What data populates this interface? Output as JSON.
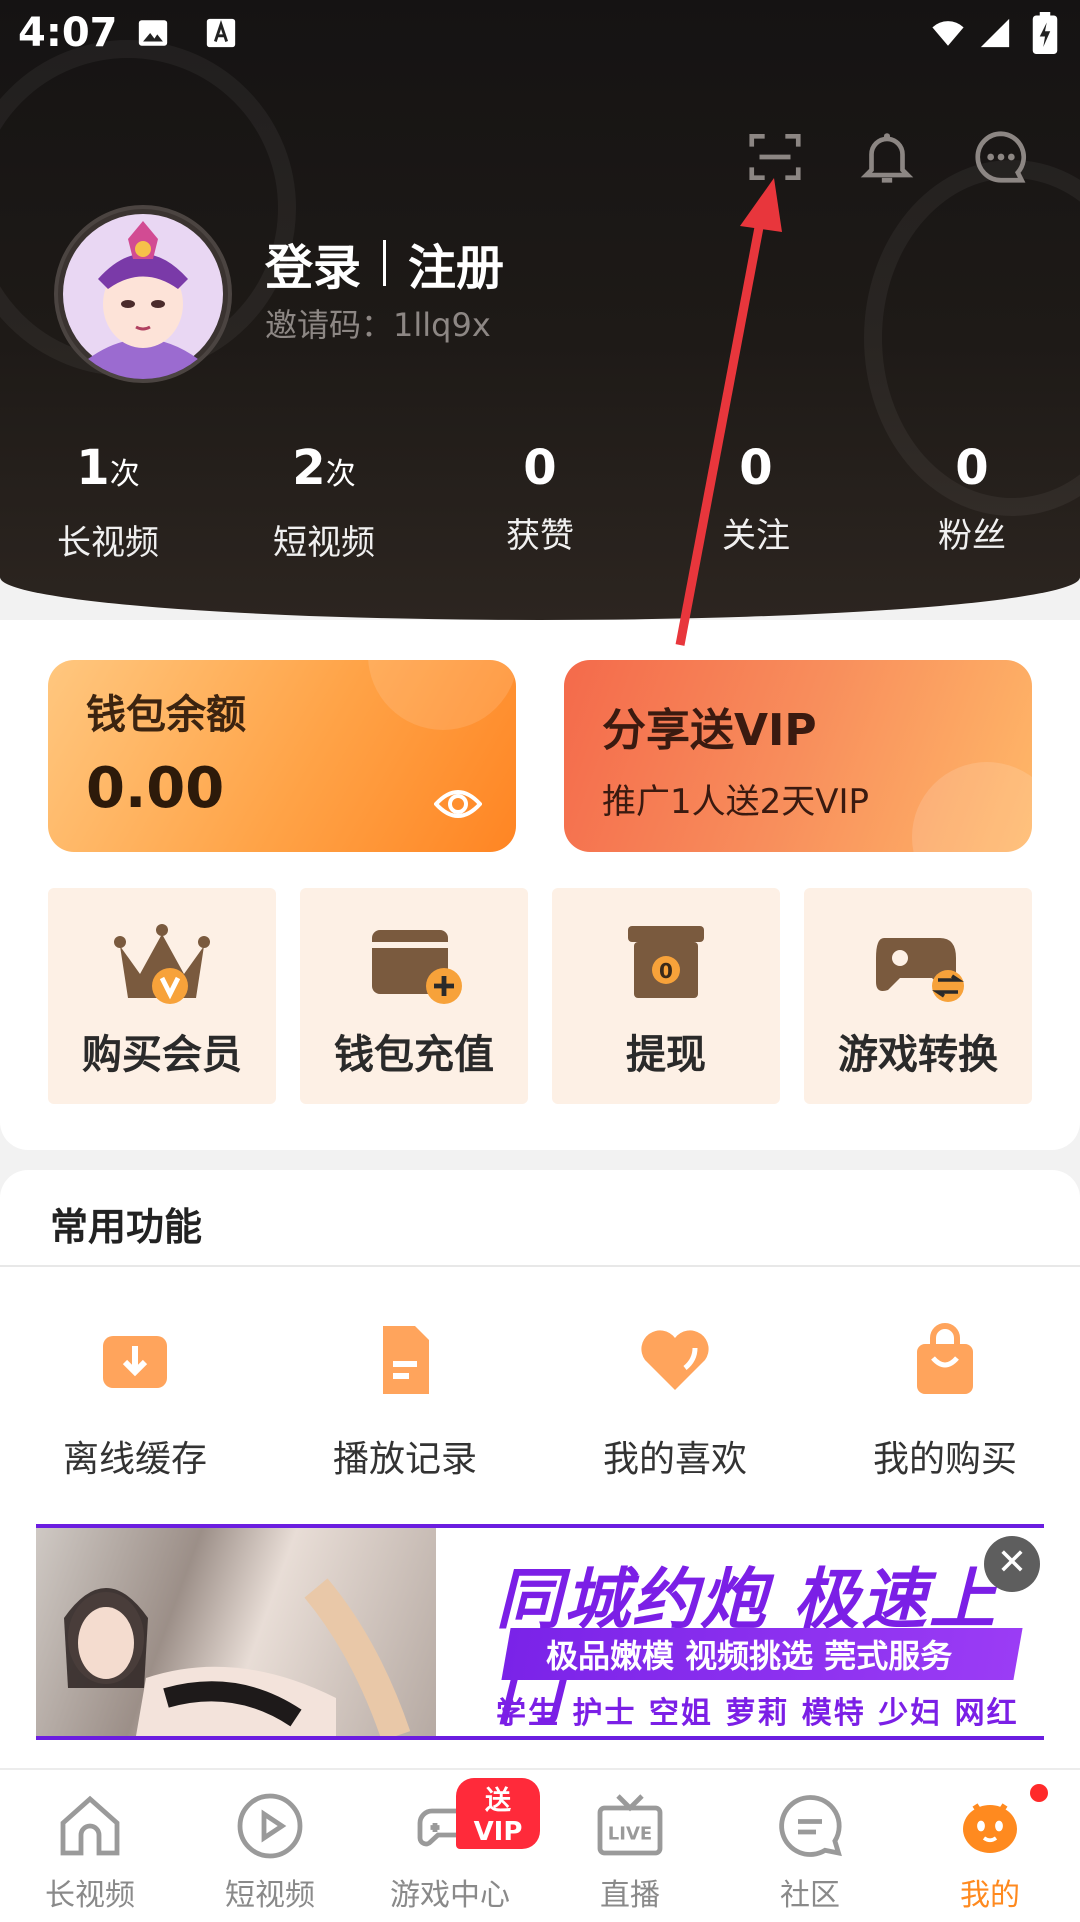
{
  "status_bar": {
    "time": "4:07"
  },
  "profile": {
    "login": "登录",
    "register": "注册",
    "invite": "邀请码：1llq9x"
  },
  "stats": [
    {
      "num": "1",
      "unit": "次",
      "label": "长视频"
    },
    {
      "num": "2",
      "unit": "次",
      "label": "短视频"
    },
    {
      "num": "0",
      "unit": "",
      "label": "获赞"
    },
    {
      "num": "0",
      "unit": "",
      "label": "关注"
    },
    {
      "num": "0",
      "unit": "",
      "label": "粉丝"
    }
  ],
  "wallet": {
    "title": "钱包余额",
    "amount": "0.00"
  },
  "share": {
    "title": "分享送VIP",
    "subtitle": "推广1人送2天VIP"
  },
  "quick_actions": [
    {
      "label": "购买会员",
      "icon": "crown-vip-icon"
    },
    {
      "label": "钱包充值",
      "icon": "wallet-add-icon"
    },
    {
      "label": "提现",
      "icon": "withdraw-box-icon"
    },
    {
      "label": "游戏转换",
      "icon": "gamepad-exchange-icon"
    }
  ],
  "common": {
    "title": "常用功能",
    "items": [
      {
        "label": "离线缓存",
        "icon": "download-icon"
      },
      {
        "label": "播放记录",
        "icon": "history-doc-icon"
      },
      {
        "label": "我的喜欢",
        "icon": "heart-icon"
      },
      {
        "label": "我的购买",
        "icon": "shopping-bag-icon"
      }
    ]
  },
  "banner": {
    "headline": "同城约炮 极速上门",
    "subline": "极品嫩模 视频挑选 莞式服务",
    "tags": "学生 护士 空姐 萝莉 模特 少妇 网红"
  },
  "nav": [
    {
      "label": "长视频",
      "icon": "home-icon"
    },
    {
      "label": "短视频",
      "icon": "play-circle-icon"
    },
    {
      "label": "游戏中心",
      "icon": "gamepad-icon",
      "badge": "送VIP"
    },
    {
      "label": "直播",
      "icon": "live-tv-icon"
    },
    {
      "label": "社区",
      "icon": "chat-bubble-icon"
    },
    {
      "label": "我的",
      "icon": "mascot-icon"
    }
  ],
  "colors": {
    "accent": "#ff8a1f",
    "header_bg": "#1b1715",
    "badge_red": "#ff2a3a",
    "banner_purple": "#7b1fe6"
  }
}
